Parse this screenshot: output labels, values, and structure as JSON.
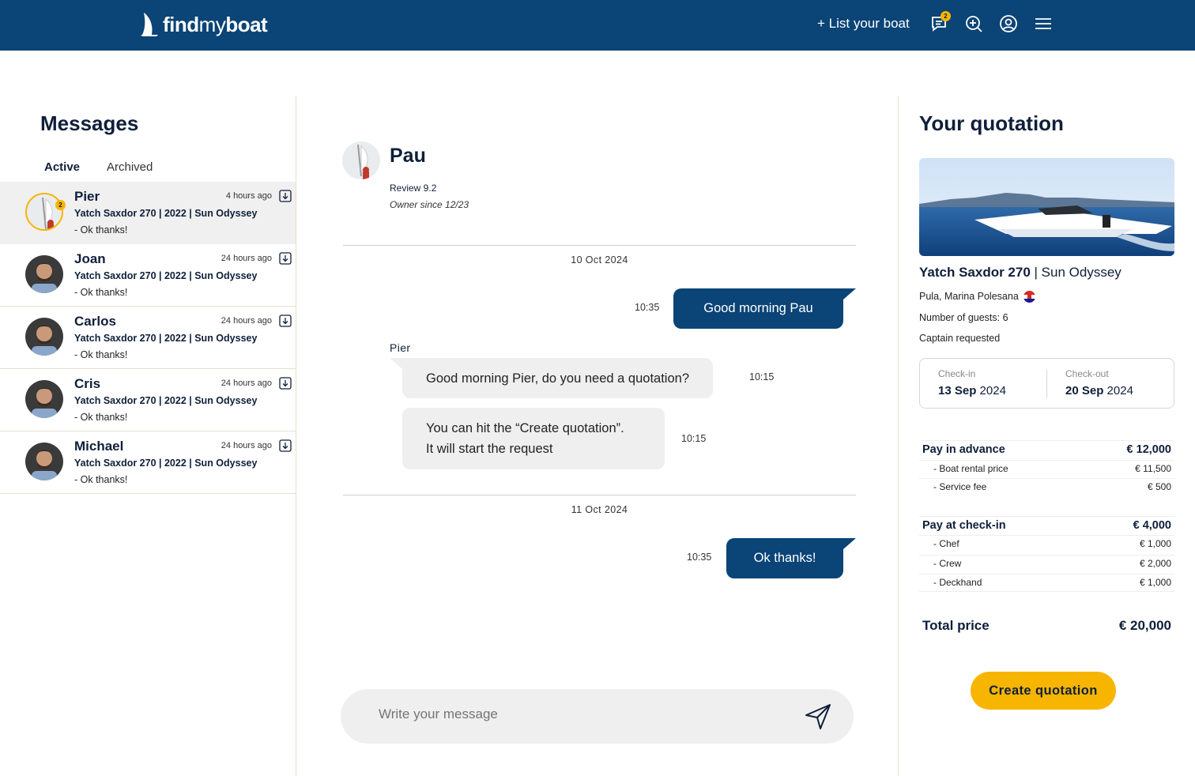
{
  "brand": {
    "part1": "find",
    "part2": "my",
    "part3": "boat"
  },
  "header": {
    "list_boat": "+ List your boat",
    "messages_badge": "2"
  },
  "messages": {
    "title": "Messages",
    "tabs": {
      "active": "Active",
      "archived": "Archived"
    },
    "conversations": [
      {
        "name": "Pier",
        "time": "4 hours ago",
        "boat": "Yatch Saxdor 270 | 2022 | Sun Odyssey",
        "last": "- Ok thanks!",
        "badge": "2"
      },
      {
        "name": "Joan",
        "time": "24 hours ago",
        "boat": "Yatch Saxdor 270 | 2022 | Sun Odyssey",
        "last": "- Ok thanks!"
      },
      {
        "name": "Carlos",
        "time": "24 hours ago",
        "boat": "Yatch Saxdor 270 | 2022 | Sun Odyssey",
        "last": "- Ok thanks!"
      },
      {
        "name": "Cris",
        "time": "24 hours ago",
        "boat": "Yatch Saxdor 270 | 2022 | Sun Odyssey",
        "last": "- Ok thanks!"
      },
      {
        "name": "Michael",
        "time": "24 hours ago",
        "boat": "Yatch Saxdor 270 | 2022 | Sun Odyssey",
        "last": "- Ok thanks!"
      }
    ]
  },
  "chat": {
    "name": "Pau",
    "review": "Review 9.2",
    "owner_since": "Owner since 12/23",
    "date1": "10 Oct 2024",
    "date2": "11 Oct 2024",
    "sender": "Pier",
    "messages": [
      {
        "text": "Good morning Pau",
        "time": "10:35"
      },
      {
        "text": "Good morning Pier, do you need a quotation?",
        "time": "10:15"
      },
      {
        "line1": "You can hit the “Create quotation”.",
        "line2": "It will start the request",
        "time": "10:15"
      },
      {
        "text": "Ok thanks!",
        "time": "10:35"
      }
    ],
    "composer_placeholder": "Write your message"
  },
  "quotation": {
    "title": "Your quotation",
    "boat_name": "Yatch Saxdor 270",
    "boat_model": " | Sun Odyssey",
    "location": "Pula, Marina Polesana",
    "guests": "Number of guests: 6",
    "captain": "Captain requested",
    "checkin_label": "Check-in",
    "checkin_day": "13 Sep",
    "checkin_year": " 2024",
    "checkout_label": "Check-out",
    "checkout_day": "20 Sep",
    "checkout_year": " 2024",
    "advance": {
      "label": "Pay in advance",
      "value": "€ 12,000"
    },
    "advance_items": [
      {
        "label": "- Boat rental price",
        "value": "€ 11,500"
      },
      {
        "label": "- Service fee",
        "value": "€ 500"
      }
    ],
    "checkin_pay": {
      "label": "Pay at check-in",
      "value": "€ 4,000"
    },
    "checkin_items": [
      {
        "label": "- Chef",
        "value": "€ 1,000"
      },
      {
        "label": "- Crew",
        "value": "€ 2,000"
      },
      {
        "label": "- Deckhand",
        "value": "€ 1,000"
      }
    ],
    "total_label": "Total price",
    "total_value": "€ 20,000",
    "cta": "Create quotation"
  },
  "colors": {
    "navy": "#0b4476",
    "accent": "#f7b500",
    "bubble_in": "#efefef"
  }
}
